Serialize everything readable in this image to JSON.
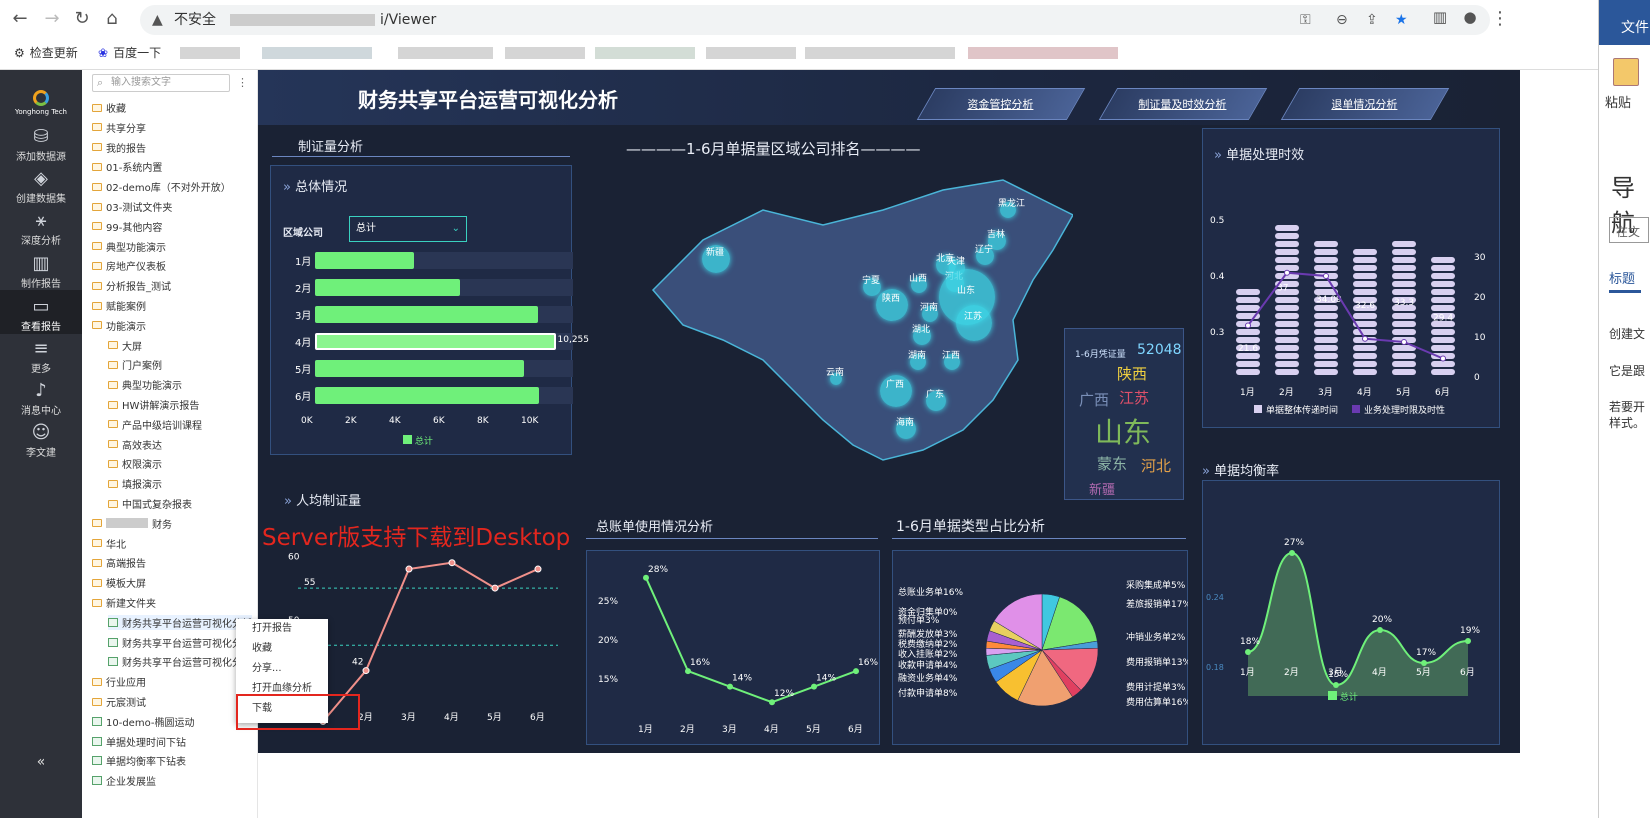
{
  "browser": {
    "security_label": "不安全",
    "url_path": "i/Viewer",
    "bookmarks": [
      "检查更新",
      "百度一下"
    ]
  },
  "word": {
    "tab": "文件",
    "paste": "粘贴",
    "nav": "导航",
    "search_ph": "在文",
    "heading_tab": "标题",
    "lines": [
      "创建文",
      "它是跟",
      "若要开",
      "样式。"
    ]
  },
  "rail": [
    {
      "label": "添加数据源"
    },
    {
      "label": "创建数据集"
    },
    {
      "label": "深度分析"
    },
    {
      "label": "制作报告"
    },
    {
      "label": "查看报告"
    },
    {
      "label": "更多"
    },
    {
      "label": "消息中心"
    },
    {
      "label": "李文建"
    }
  ],
  "tree": {
    "search_placeholder": "输入搜索文字",
    "items": [
      "收藏",
      "共享分享",
      "我的报告",
      "01-系统内置",
      "02-demo库（不对外开放）",
      "03-测试文件夹",
      "99-其他内容",
      "典型功能演示",
      "房地产仪表板",
      "分析报告_测试",
      "赋能案例",
      "功能演示",
      "大屏",
      "门户案例",
      "典型功能演示",
      "HW讲解演示报告",
      "产品中级培训课程",
      "高效表达",
      "权限演示",
      "填报演示",
      "中国式复杂报表",
      "财务",
      "华北",
      "高端报告",
      "模板大屏",
      "新建文件夹",
      "财务共享平台运营可视化分析",
      "财务共享平台运营可视化分",
      "财务共享平台运营可视化分",
      "行业应用",
      "元宸测试",
      "10-demo-椭圆运动",
      "单据处理时间下钻",
      "单据均衡率下钻表",
      "企业发展监"
    ]
  },
  "dash": {
    "title": "财务共享平台运营可视化分析",
    "tabs": [
      "资金管控分析",
      "制证量及时效分析",
      "退单情况分析"
    ],
    "s1": "制证量分析",
    "overall": "总体情况",
    "filter_label": "区域公司",
    "filter_value": "总计",
    "bar_legend": "总计",
    "bar_value_label": "10,255",
    "map_title": "1-6月单据量区域公司排名",
    "map_labels": [
      "黑龙江",
      "吉林",
      "辽宁",
      "北京",
      "天津",
      "河北",
      "新疆",
      "宁夏",
      "山西",
      "山东",
      "陕西",
      "河南",
      "江苏",
      "湖北",
      "湖南",
      "江西",
      "云南",
      "广西",
      "广东",
      "海南"
    ],
    "wc_label": "1-6月凭证量",
    "wc_value": "52048",
    "wc_words": [
      "陕西",
      "广西",
      "江苏",
      "山东",
      "蒙东",
      "河北",
      "新疆"
    ],
    "eff_title": "单据处理时效",
    "eff_legend": [
      "单据整体传递时间",
      "业务处理时限及时性"
    ],
    "bal_title": "单据均衡率",
    "bal_legend": "总计",
    "per_title": "人均制证量",
    "ledger_title": "总账单使用情况分析",
    "pie_title": "1-6月单据类型占比分析"
  },
  "context_menu": [
    "打开报告",
    "收藏",
    "分享...",
    "打开血缘分析",
    "下载"
  ],
  "annotation": "Server版支持下载到Desktop",
  "chart_data": [
    {
      "type": "bar",
      "orientation": "horizontal",
      "categories": [
        "1月",
        "2月",
        "3月",
        "4月",
        "5月",
        "6月"
      ],
      "values": [
        4200,
        6200,
        9500,
        10255,
        8900,
        9550
      ],
      "xticks": [
        "0K",
        "2K",
        "4K",
        "6K",
        "8K",
        "10K"
      ],
      "xlim": [
        0,
        11000
      ],
      "legend": "总计"
    },
    {
      "type": "line",
      "title": "人均制证量",
      "categories": [
        "1月",
        "2月",
        "3月",
        "4月",
        "5月",
        "6月"
      ],
      "values": [
        34,
        42,
        58,
        59,
        55,
        58
      ],
      "data_labels": [
        "",
        "42",
        "",
        "",
        "",
        ""
      ],
      "reference_lines": [
        55,
        46
      ],
      "yticks": [
        "50",
        "60"
      ],
      "ylim": [
        35,
        61
      ]
    },
    {
      "type": "line",
      "title": "总账单使用情况分析",
      "categories": [
        "1月",
        "2月",
        "3月",
        "4月",
        "5月",
        "6月"
      ],
      "values": [
        28,
        16,
        14,
        12,
        14,
        16
      ],
      "data_labels": [
        "28%",
        "16%",
        "14%",
        "12%",
        "14%",
        "16%"
      ],
      "yticks": [
        "15%",
        "20%",
        "25%"
      ],
      "ylim": [
        11,
        29
      ]
    },
    {
      "type": "pie",
      "title": "1-6月单据类型占比分析",
      "slices": [
        {
          "label": "采购集成单",
          "value": 5
        },
        {
          "label": "差旅报销单",
          "value": 17
        },
        {
          "label": "冲销业务单",
          "value": 2
        },
        {
          "label": "费用报销单",
          "value": 13
        },
        {
          "label": "费用计提单",
          "value": 3
        },
        {
          "label": "费用估算单",
          "value": 16
        },
        {
          "label": "付款申请单",
          "value": 8
        },
        {
          "label": "融资业务单",
          "value": 4
        },
        {
          "label": "收款申请单",
          "value": 4
        },
        {
          "label": "收入挂账单",
          "value": 2
        },
        {
          "label": "税费缴纳单",
          "value": 2
        },
        {
          "label": "薪酬发放单",
          "value": 3
        },
        {
          "label": "预付单",
          "value": 3
        },
        {
          "label": "资金归集单",
          "value": 0
        },
        {
          "label": "总账业务单",
          "value": 16
        }
      ]
    },
    {
      "type": "bar",
      "title": "单据处理时效",
      "categories": [
        "1月",
        "2月",
        "3月",
        "4月",
        "5月",
        "6月"
      ],
      "series": [
        {
          "name": "单据整体传递时间",
          "values": [
            21.6,
            37,
            34.09,
            32.6,
            33.3,
            29.4
          ]
        },
        {
          "name": "业务处理时限及时性",
          "values": [
            0.35,
            0.51,
            0.5,
            0.31,
            0.3,
            0.25
          ]
        }
      ],
      "yticks_left": [
        "0.3",
        "0.4",
        "0.5"
      ],
      "yticks_right": [
        "0",
        "10",
        "20",
        "30"
      ],
      "data_labels": [
        "21.6",
        "37",
        "34.09",
        "32.6",
        "33.3",
        "29.4"
      ]
    },
    {
      "type": "area",
      "title": "单据均衡率",
      "categories": [
        "1月",
        "2月",
        "3月",
        "4月",
        "5月",
        "6月"
      ],
      "values": [
        18,
        27,
        15,
        20,
        17,
        19
      ],
      "data_labels": [
        "18%",
        "27%",
        "15%",
        "20%",
        "17%",
        "19%"
      ],
      "yticks": [
        "0.18",
        "0.24"
      ],
      "legend": "总计"
    }
  ]
}
